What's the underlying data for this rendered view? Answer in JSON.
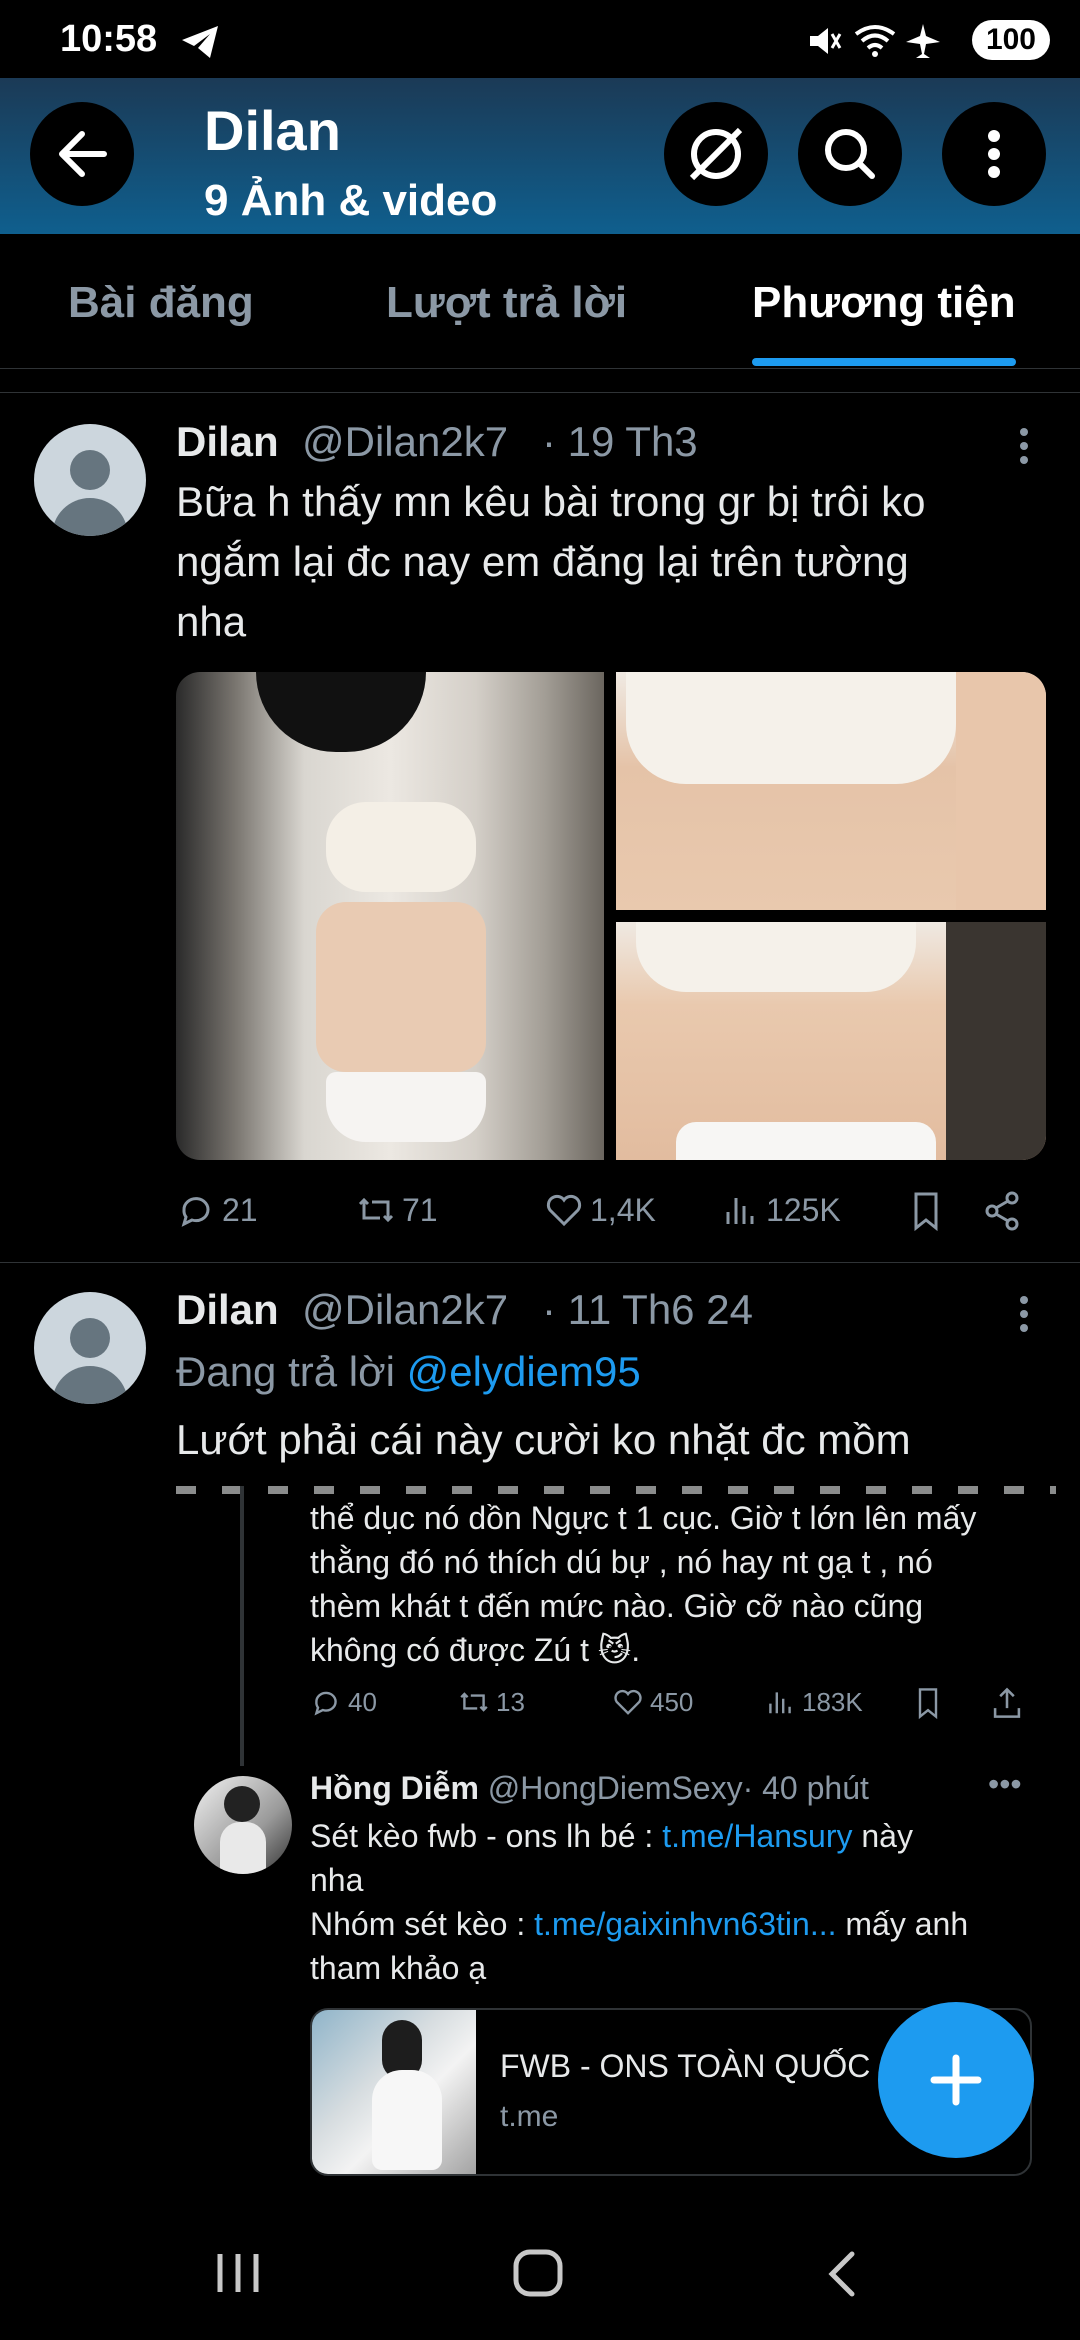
{
  "status": {
    "time": "10:58",
    "battery": "100"
  },
  "header": {
    "title": "Dilan",
    "subtitle": "9 Ảnh & video"
  },
  "tabs": [
    {
      "label": "Bài đăng"
    },
    {
      "label": "Lượt trả lời"
    },
    {
      "label": "Phương tiện"
    }
  ],
  "post1": {
    "name": "Dilan",
    "handle": "@Dilan2k7",
    "date": "· 19 Th3",
    "text_l1": "Bữa h thấy mn kêu bài trong gr bị trôi ko",
    "text_l2": "ngắm lại đc nay em đăng lại trên tường",
    "text_l3": "nha",
    "replies": "21",
    "retweets": "71",
    "likes": "1,4K",
    "views": "125K"
  },
  "post2": {
    "name": "Dilan",
    "handle": "@Dilan2k7",
    "date": "· 11 Th6 24",
    "replying_prefix": "Đang trả lời",
    "replying_to": "@elydiem95",
    "text": "Lướt phải cái này cười ko nhặt đc mồm",
    "quoted": {
      "line1": "thể dục nó dồn Ngực t 1 cục. Giờ t lớn lên mấy",
      "line2": "thằng đó nó thích dú bự , nó hay nt gạ t , nó",
      "line3": "thèm khát t đến mức nào. Giờ cỡ nào cũng",
      "line4": "không có được Zú t",
      "emoji": "😼",
      "line4_end": ".",
      "replies": "40",
      "retweets": "13",
      "likes": "450",
      "views": "183K"
    },
    "reply": {
      "name": "Hồng Diễm",
      "handle": "@HongDiemSexy",
      "time": "· 40 phút",
      "l1_a": "Sét kèo fwb - ons lh bé : ",
      "l1_link": "t.me/Hansury",
      "l1_b": " này",
      "l2": "nha",
      "l3_a": "Nhóm sét kèo : ",
      "l3_link": "t.me/gaixinhvn63tin...",
      "l3_b": " mấy anh",
      "l4": "tham khảo ạ",
      "card_title": "FWB - ONS TOÀN QUỐC",
      "card_domain": "t.me"
    }
  },
  "colors": {
    "accent": "#1d9bf0",
    "background": "#000000",
    "muted": "#8b98a5"
  }
}
